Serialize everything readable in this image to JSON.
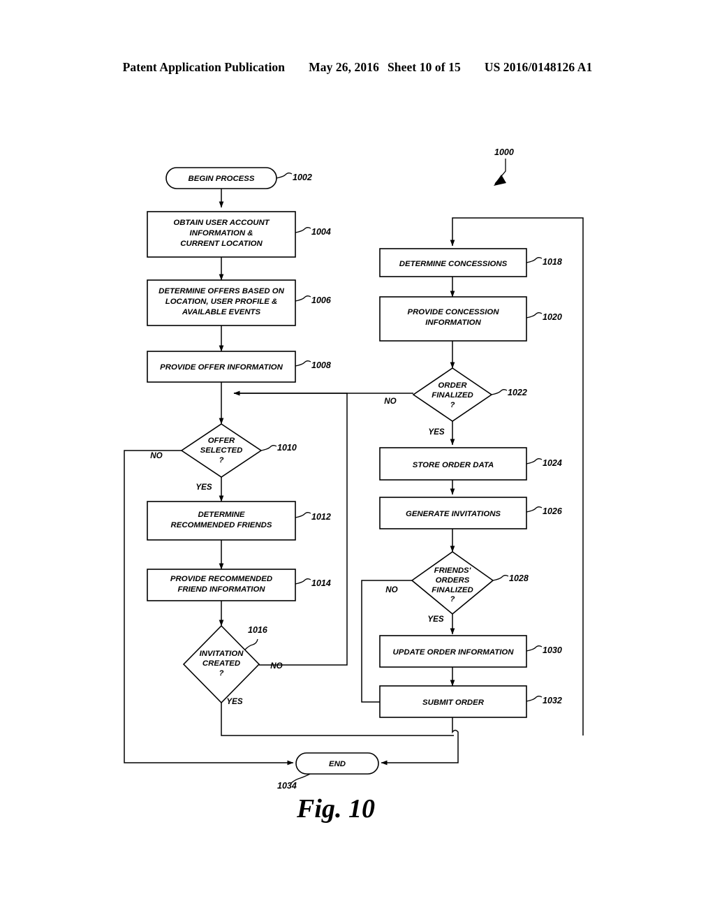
{
  "header": {
    "publication": "Patent Application Publication",
    "date": "May 26, 2016",
    "sheet": "Sheet 10 of 15",
    "patent_number": "US 2016/0148126 A1"
  },
  "figure": {
    "caption": "Fig. 10",
    "diagram_ref": "1000",
    "type": "flowchart"
  },
  "nodes": [
    {
      "id": "1002",
      "ref": "1002",
      "shape": "terminator",
      "lines": [
        "BEGIN PROCESS"
      ]
    },
    {
      "id": "1004",
      "ref": "1004",
      "shape": "process",
      "lines": [
        "OBTAIN USER ACCOUNT",
        "INFORMATION &",
        "CURRENT LOCATION"
      ]
    },
    {
      "id": "1006",
      "ref": "1006",
      "shape": "process",
      "lines": [
        "DETERMINE OFFERS BASED ON",
        "LOCATION, USER PROFILE &",
        "AVAILABLE EVENTS"
      ]
    },
    {
      "id": "1008",
      "ref": "1008",
      "shape": "process",
      "lines": [
        "PROVIDE OFFER INFORMATION"
      ]
    },
    {
      "id": "1010",
      "ref": "1010",
      "shape": "decision",
      "lines": [
        "OFFER",
        "SELECTED",
        "?"
      ]
    },
    {
      "id": "1012",
      "ref": "1012",
      "shape": "process",
      "lines": [
        "DETERMINE",
        "RECOMMENDED FRIENDS"
      ]
    },
    {
      "id": "1014",
      "ref": "1014",
      "shape": "process",
      "lines": [
        "PROVIDE RECOMMENDED",
        "FRIEND INFORMATION"
      ]
    },
    {
      "id": "1016",
      "ref": "1016",
      "shape": "decision",
      "lines": [
        "INVITATION",
        "CREATED",
        "?"
      ]
    },
    {
      "id": "1018",
      "ref": "1018",
      "shape": "process",
      "lines": [
        "DETERMINE CONCESSIONS"
      ]
    },
    {
      "id": "1020",
      "ref": "1020",
      "shape": "process",
      "lines": [
        "PROVIDE CONCESSION",
        "INFORMATION"
      ]
    },
    {
      "id": "1022",
      "ref": "1022",
      "shape": "decision",
      "lines": [
        "ORDER",
        "FINALIZED",
        "?"
      ]
    },
    {
      "id": "1024",
      "ref": "1024",
      "shape": "process",
      "lines": [
        "STORE ORDER DATA"
      ]
    },
    {
      "id": "1026",
      "ref": "1026",
      "shape": "process",
      "lines": [
        "GENERATE INVITATIONS"
      ]
    },
    {
      "id": "1028",
      "ref": "1028",
      "shape": "decision",
      "lines": [
        "FRIENDS'",
        "ORDERS",
        "FINALIZED",
        "?"
      ]
    },
    {
      "id": "1030",
      "ref": "1030",
      "shape": "process",
      "lines": [
        "UPDATE ORDER INFORMATION"
      ]
    },
    {
      "id": "1032",
      "ref": "1032",
      "shape": "process",
      "lines": [
        "SUBMIT ORDER"
      ]
    },
    {
      "id": "1034",
      "ref": "1034",
      "shape": "terminator",
      "lines": [
        "END"
      ]
    }
  ],
  "branch_labels": {
    "offer_selected_no": "NO",
    "offer_selected_yes": "YES",
    "invitation_created_no": "NO",
    "invitation_created_yes": "YES",
    "order_finalized_no": "NO",
    "order_finalized_yes": "YES",
    "friends_orders_no": "NO",
    "friends_orders_yes": "YES"
  },
  "text": {
    "n1002_l1": "BEGIN PROCESS",
    "n1004_l1": "OBTAIN USER ACCOUNT",
    "n1004_l2": "INFORMATION &",
    "n1004_l3": "CURRENT LOCATION",
    "n1006_l1": "DETERMINE OFFERS BASED ON",
    "n1006_l2": "LOCATION, USER PROFILE &",
    "n1006_l3": "AVAILABLE EVENTS",
    "n1008_l1": "PROVIDE OFFER INFORMATION",
    "n1010_l1": "OFFER",
    "n1010_l2": "SELECTED",
    "n1010_l3": "?",
    "n1012_l1": "DETERMINE",
    "n1012_l2": "RECOMMENDED FRIENDS",
    "n1014_l1": "PROVIDE RECOMMENDED",
    "n1014_l2": "FRIEND INFORMATION",
    "n1016_l1": "INVITATION",
    "n1016_l2": "CREATED",
    "n1016_l3": "?",
    "n1018_l1": "DETERMINE CONCESSIONS",
    "n1020_l1": "PROVIDE CONCESSION",
    "n1020_l2": "INFORMATION",
    "n1022_l1": "ORDER",
    "n1022_l2": "FINALIZED",
    "n1022_l3": "?",
    "n1024_l1": "STORE ORDER DATA",
    "n1026_l1": "GENERATE INVITATIONS",
    "n1028_l1": "FRIENDS'",
    "n1028_l2": "ORDERS",
    "n1028_l3": "FINALIZED",
    "n1028_l4": "?",
    "n1030_l1": "UPDATE ORDER INFORMATION",
    "n1032_l1": "SUBMIT ORDER",
    "n1034_l1": "END"
  },
  "refs": {
    "r1000": "1000",
    "r1002": "1002",
    "r1004": "1004",
    "r1006": "1006",
    "r1008": "1008",
    "r1010": "1010",
    "r1012": "1012",
    "r1014": "1014",
    "r1016": "1016",
    "r1018": "1018",
    "r1020": "1020",
    "r1022": "1022",
    "r1024": "1024",
    "r1026": "1026",
    "r1028": "1028",
    "r1030": "1030",
    "r1032": "1032",
    "r1034": "1034"
  },
  "colors": {
    "ink": "#000000",
    "paper": "#ffffff"
  }
}
